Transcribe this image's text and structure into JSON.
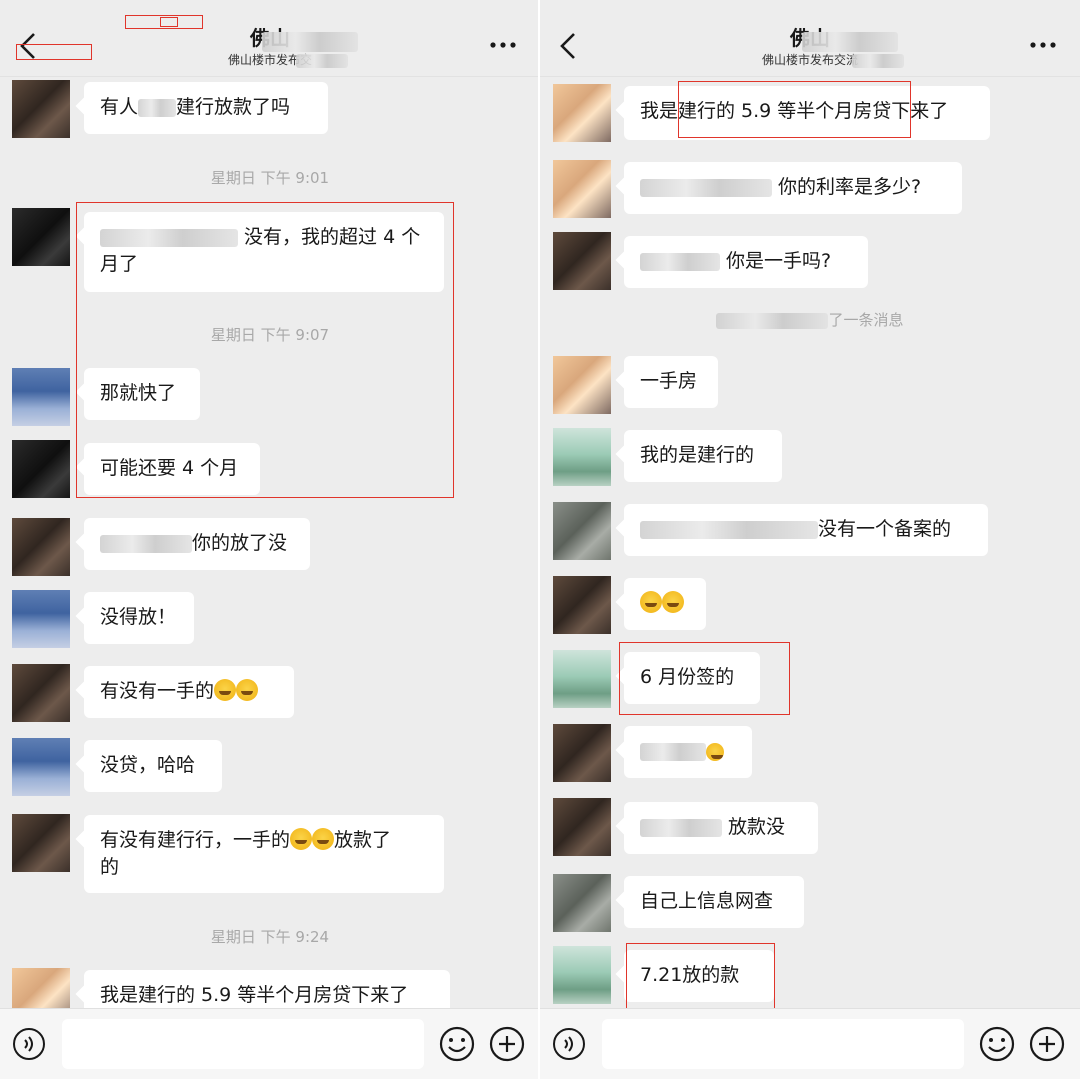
{
  "left": {
    "header": {
      "title": "佛山",
      "subtitle": "佛山楼市发布交",
      "more_label": "•••"
    },
    "times": [
      "星期日 下午 9:01",
      "星期日 下午 9:07",
      "星期日 下午 9:24"
    ],
    "messages": [
      {
        "text": "有人",
        "text2": "建行放款了吗"
      },
      {
        "text": "没有，我的超过 4 个",
        "text2": "月了"
      },
      {
        "text": "那就快了"
      },
      {
        "text": "可能还要 4 个月"
      },
      {
        "text": "你的放了没"
      },
      {
        "text": "没得放！"
      },
      {
        "text": "有没有一手的"
      },
      {
        "text": "没贷，哈哈"
      },
      {
        "text": "有没有建行行，一手的",
        "text2": "放款了",
        "text3": "的"
      },
      {
        "text": "我是建行的 5.9 等半个月房贷下来了"
      }
    ]
  },
  "right": {
    "header": {
      "title": "佛山",
      "subtitle": "佛山楼市发布交流",
      "more_label": "•••"
    },
    "system": "了一条消息",
    "messages": [
      {
        "text": "我是建行的 5.9 等半个月房贷下来了"
      },
      {
        "text": "你的利率是多少?"
      },
      {
        "text": "你是一手吗?"
      },
      {
        "text": "一手房"
      },
      {
        "text": "我的是建行的"
      },
      {
        "text": "没有一个备案的"
      },
      {
        "text": ""
      },
      {
        "text": "6 月份签的"
      },
      {
        "text": ""
      },
      {
        "text": "放款没"
      },
      {
        "text": "自己上信息网查"
      },
      {
        "text": "7.21放的款"
      }
    ]
  },
  "colors": {
    "background": "#ededed",
    "bubble": "#ffffff",
    "highlight_box": "#e0352b",
    "timestamp": "#a8a8a8"
  }
}
